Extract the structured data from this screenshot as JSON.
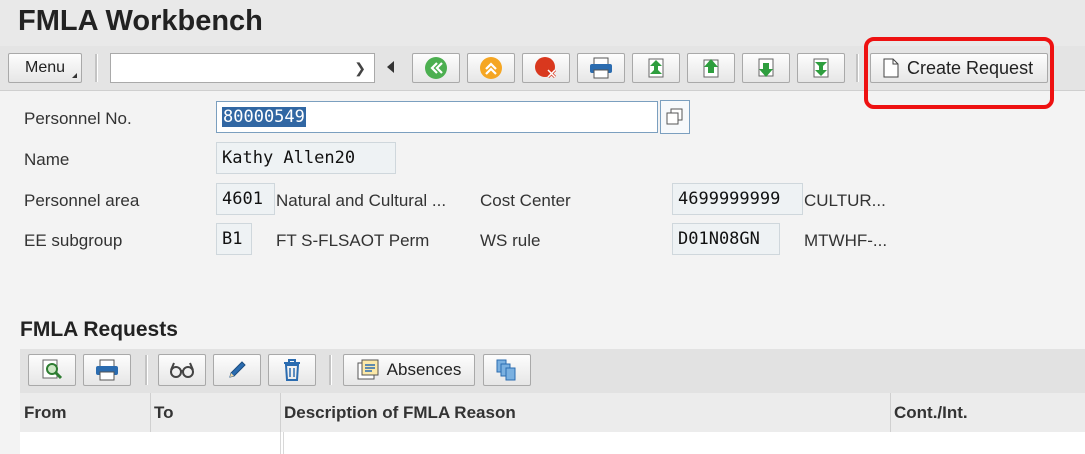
{
  "app": {
    "title": "FMLA Workbench"
  },
  "toolbar": {
    "menu_label": "Menu",
    "combo_value": "",
    "create_label": "Create Request",
    "icons": [
      "first-page-icon",
      "previous-page-icon",
      "exit-icon",
      "print-icon",
      "first-record-icon",
      "previous-record-icon",
      "next-record-icon",
      "last-record-icon"
    ]
  },
  "form": {
    "personnel_no": {
      "label": "Personnel No.",
      "value": "80000549"
    },
    "name": {
      "label": "Name",
      "value": "Kathy Allen20"
    },
    "personnel_area": {
      "label": "Personnel area",
      "code": "4601",
      "text": "Natural and Cultural ..."
    },
    "cost_center": {
      "label": "Cost Center",
      "code": "4699999999",
      "text": "CULTUR..."
    },
    "ee_subgroup": {
      "label": "EE subgroup",
      "code": "B1",
      "text": "FT S-FLSAOT Perm"
    },
    "ws_rule": {
      "label": "WS rule",
      "code": "D01N08GN",
      "text": "MTWHF-..."
    }
  },
  "requests": {
    "title": "FMLA Requests",
    "absences_label": "Absences",
    "columns": [
      "From",
      "To",
      "Description of FMLA Reason",
      "Cont./Int."
    ],
    "rows": []
  },
  "colors": {
    "highlight": "#e11111",
    "selection": "#3167a3"
  }
}
